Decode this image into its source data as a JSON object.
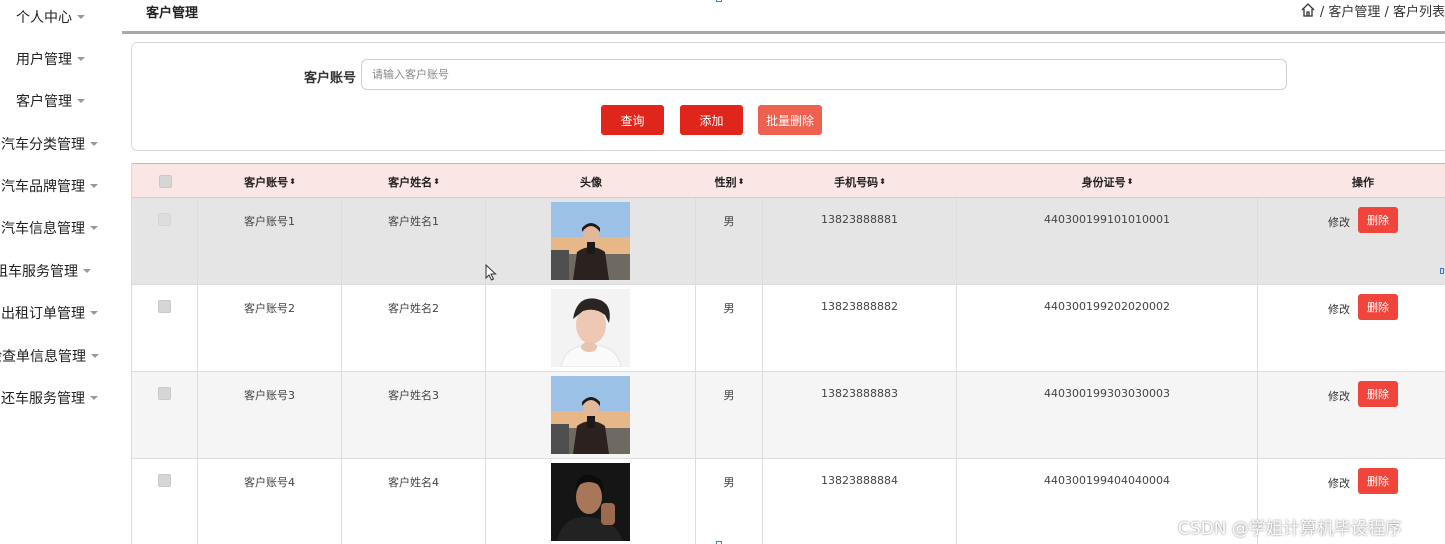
{
  "sidebar": {
    "items": [
      {
        "label": "个人中心"
      },
      {
        "label": "用户管理"
      },
      {
        "label": "客户管理"
      },
      {
        "label": "汽车分类管理"
      },
      {
        "label": "汽车品牌管理"
      },
      {
        "label": "汽车信息管理"
      },
      {
        "label": "租车服务管理"
      },
      {
        "label": "出租订单管理"
      },
      {
        "label": "检查单信息管理"
      },
      {
        "label": "还车服务管理"
      }
    ]
  },
  "header": {
    "title": "客户管理",
    "breadcrumb": " / 客户管理 / 客户列表"
  },
  "search": {
    "label": "客户账号",
    "placeholder": "请输入客户账号",
    "query_label": "查询",
    "add_label": "添加",
    "batch_delete_label": "批量删除"
  },
  "table": {
    "columns": [
      "客户账号",
      "客户姓名",
      "头像",
      "性别",
      "手机号码",
      "身份证号",
      "操作"
    ],
    "sort_glyph": "⬍",
    "rows": [
      {
        "account": "客户账号1",
        "name": "客户姓名1",
        "gender": "男",
        "phone": "13823888881",
        "id_card": "440300199101010001"
      },
      {
        "account": "客户账号2",
        "name": "客户姓名2",
        "gender": "男",
        "phone": "13823888882",
        "id_card": "440300199202020002"
      },
      {
        "account": "客户账号3",
        "name": "客户姓名3",
        "gender": "男",
        "phone": "13823888883",
        "id_card": "440300199303030003"
      },
      {
        "account": "客户账号4",
        "name": "客户姓名4",
        "gender": "男",
        "phone": "13823888884",
        "id_card": "440300199404040004"
      }
    ],
    "edit_label": "修改",
    "delete_label": "删除"
  },
  "watermark": "CSDN @学姐计算机毕设程序",
  "colors": {
    "primary_red": "#e0261b",
    "header_pink": "#fbe6e6"
  }
}
